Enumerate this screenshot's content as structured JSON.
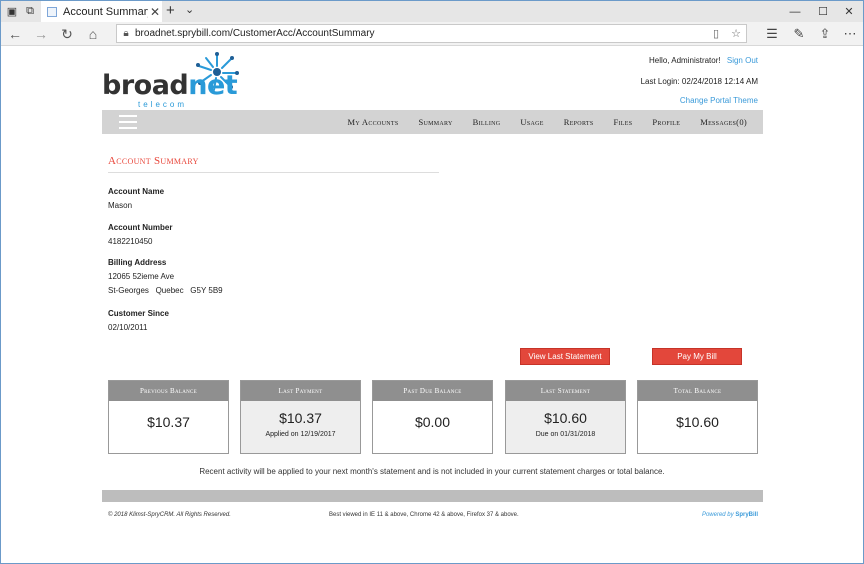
{
  "browser": {
    "tab_title": "Account Summary - Cus",
    "url": "broadnet.sprybill.com/CustomerAcc/AccountSummary"
  },
  "brand": {
    "word_a": "broad",
    "word_b": "net",
    "sub": "telecom"
  },
  "header": {
    "greeting": "Hello, Administrator!",
    "sign_out": "Sign Out",
    "last_login": "Last Login: 02/24/2018 12:14 AM",
    "change_theme": "Change Portal Theme"
  },
  "nav": {
    "items": [
      "My Accounts",
      "Summary",
      "Billing",
      "Usage",
      "Reports",
      "Files",
      "Profile",
      "Messages(0)"
    ]
  },
  "summary": {
    "title": "Account Summary",
    "account_name_label": "Account Name",
    "account_name": "Mason",
    "account_number_label": "Account Number",
    "account_number": "4182210450",
    "billing_address_label": "Billing Address",
    "address_line1": "12065 52ieme Ave",
    "address_city": "St-Georges",
    "address_prov": "Quebec",
    "address_postal": "G5Y 5B9",
    "customer_since_label": "Customer Since",
    "customer_since": "02/10/2011"
  },
  "actions": {
    "view_last_statement": "View Last Statement",
    "pay_my_bill": "Pay My Bill"
  },
  "cards": [
    {
      "header": "Previous Balance",
      "amount": "$10.37",
      "sub": ""
    },
    {
      "header": "Last Payment",
      "amount": "$10.37",
      "sub": "Applied on 12/19/2017"
    },
    {
      "header": "Past Due Balance",
      "amount": "$0.00",
      "sub": ""
    },
    {
      "header": "Last Statement",
      "amount": "$10.60",
      "sub": "Due on 01/31/2018"
    },
    {
      "header": "Total Balance",
      "amount": "$10.60",
      "sub": ""
    }
  ],
  "notice": "Recent activity will be applied to your next month's statement and is not included in your current statement charges or total balance.",
  "footer": {
    "copyright": "© 2018 Klimst-SpryCRM. All Rights Reserved.",
    "best_viewed": "Best viewed in IE 11 & above, Chrome 42 & above, Firefox 37 & above.",
    "powered_by": "Powered by",
    "powered_brand": "SpryBill"
  },
  "colors": {
    "accent": "#e3473b",
    "link": "#3a9ad9",
    "nav_bg": "#d3d3d3"
  }
}
